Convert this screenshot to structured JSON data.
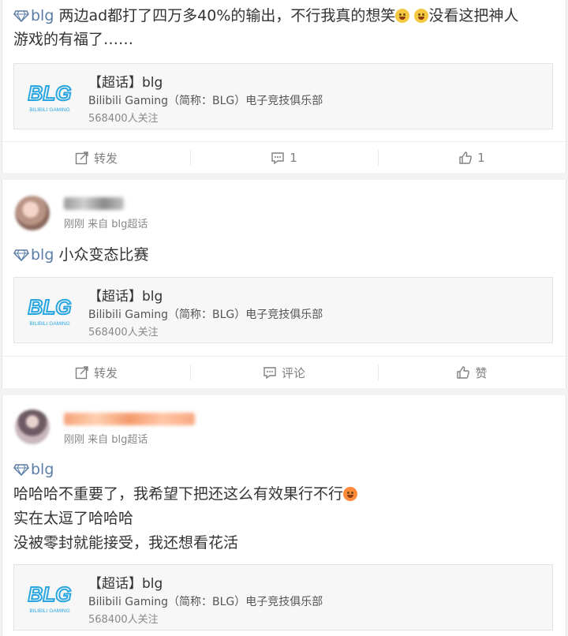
{
  "colors": {
    "link": "#5b7da6",
    "logo_blue": "#29a6e0",
    "action_gray": "#808080"
  },
  "posts": [
    {
      "topic": "blg",
      "text_1": " 两边ad都打了四万多40%的输出，不行我真的想笑",
      "text_2": "没看这把神人",
      "text_3": "游戏的有福了……",
      "emojis": [
        "laugh-cry-emoji",
        "laugh-cry-emoji"
      ],
      "card": {
        "logo_text": "BLG",
        "logo_subtext": "BILIBILI GAMING",
        "title": "【超话】blg",
        "desc": "Bilibili Gaming（简称：BLG）电子竞技俱乐部",
        "followers": "568400人关注"
      },
      "actions": {
        "repost": "转发",
        "comment": "1",
        "like": "1"
      }
    },
    {
      "meta": "刚刚 来自 blg超话",
      "topic": "blg",
      "text_1": " 小众变态比赛",
      "card": {
        "logo_text": "BLG",
        "logo_subtext": "BILIBILI GAMING",
        "title": "【超话】blg",
        "desc": "Bilibili Gaming（简称：BLG）电子竞技俱乐部",
        "followers": "568400人关注"
      },
      "actions": {
        "repost": "转发",
        "comment": "评论",
        "like": "赞"
      }
    },
    {
      "meta": "刚刚 来自 blg超话",
      "topic": "blg",
      "text_1": "哈哈哈不重要了，我希望下把还这么有效果行不行",
      "text_2": "实在太逗了哈哈哈",
      "text_3": "没被零封就能接受，我还想看花活",
      "emojis": [
        "hot-face-emoji"
      ],
      "card": {
        "logo_text": "BLG",
        "logo_subtext": "BILIBILI GAMING",
        "title": "【超话】blg",
        "desc": "Bilibili Gaming（简称：BLG）电子竞技俱乐部",
        "followers": "568400人关注"
      }
    }
  ]
}
